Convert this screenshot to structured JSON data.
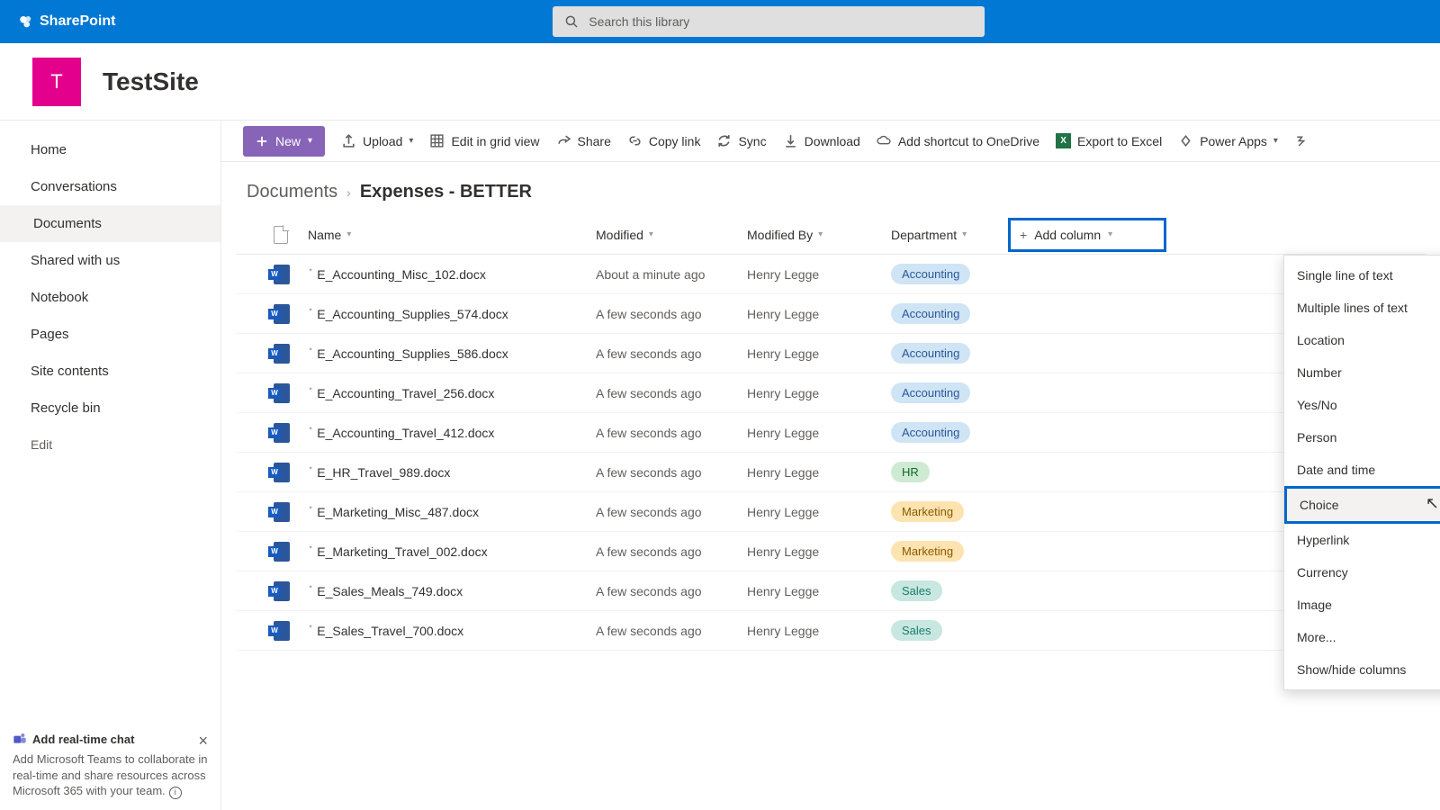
{
  "brand": "SharePoint",
  "search": {
    "placeholder": "Search this library"
  },
  "site": {
    "initial": "T",
    "name": "TestSite"
  },
  "nav": {
    "items": [
      "Home",
      "Conversations",
      "Documents",
      "Shared with us",
      "Notebook",
      "Pages",
      "Site contents",
      "Recycle bin"
    ],
    "active_index": 2,
    "edit": "Edit"
  },
  "promo": {
    "title": "Add real-time chat",
    "body": "Add Microsoft Teams to collaborate in real-time and share resources across Microsoft 365 with your team."
  },
  "cmdbar": {
    "new": "New",
    "upload": "Upload",
    "edit_grid": "Edit in grid view",
    "share": "Share",
    "copy_link": "Copy link",
    "sync": "Sync",
    "download": "Download",
    "shortcut": "Add shortcut to OneDrive",
    "export": "Export to Excel",
    "powerapps": "Power Apps"
  },
  "breadcrumb": {
    "root": "Documents",
    "current": "Expenses - BETTER"
  },
  "columns": {
    "name": "Name",
    "modified": "Modified",
    "modified_by": "Modified By",
    "department": "Department",
    "add": "Add column"
  },
  "rows": [
    {
      "name": "E_Accounting_Misc_102.docx",
      "modified": "About a minute ago",
      "by": "Henry Legge",
      "dept": "Accounting",
      "dept_class": "acc"
    },
    {
      "name": "E_Accounting_Supplies_574.docx",
      "modified": "A few seconds ago",
      "by": "Henry Legge",
      "dept": "Accounting",
      "dept_class": "acc"
    },
    {
      "name": "E_Accounting_Supplies_586.docx",
      "modified": "A few seconds ago",
      "by": "Henry Legge",
      "dept": "Accounting",
      "dept_class": "acc"
    },
    {
      "name": "E_Accounting_Travel_256.docx",
      "modified": "A few seconds ago",
      "by": "Henry Legge",
      "dept": "Accounting",
      "dept_class": "acc"
    },
    {
      "name": "E_Accounting_Travel_412.docx",
      "modified": "A few seconds ago",
      "by": "Henry Legge",
      "dept": "Accounting",
      "dept_class": "acc"
    },
    {
      "name": "E_HR_Travel_989.docx",
      "modified": "A few seconds ago",
      "by": "Henry Legge",
      "dept": "HR",
      "dept_class": "hr"
    },
    {
      "name": "E_Marketing_Misc_487.docx",
      "modified": "A few seconds ago",
      "by": "Henry Legge",
      "dept": "Marketing",
      "dept_class": "mkt"
    },
    {
      "name": "E_Marketing_Travel_002.docx",
      "modified": "A few seconds ago",
      "by": "Henry Legge",
      "dept": "Marketing",
      "dept_class": "mkt"
    },
    {
      "name": "E_Sales_Meals_749.docx",
      "modified": "A few seconds ago",
      "by": "Henry Legge",
      "dept": "Sales",
      "dept_class": "sal"
    },
    {
      "name": "E_Sales_Travel_700.docx",
      "modified": "A few seconds ago",
      "by": "Henry Legge",
      "dept": "Sales",
      "dept_class": "sal"
    }
  ],
  "addcol_menu": {
    "items": [
      "Single line of text",
      "Multiple lines of text",
      "Location",
      "Number",
      "Yes/No",
      "Person",
      "Date and time",
      "Choice",
      "Hyperlink",
      "Currency",
      "Image",
      "More...",
      "Show/hide columns"
    ],
    "hover_index": 7
  }
}
